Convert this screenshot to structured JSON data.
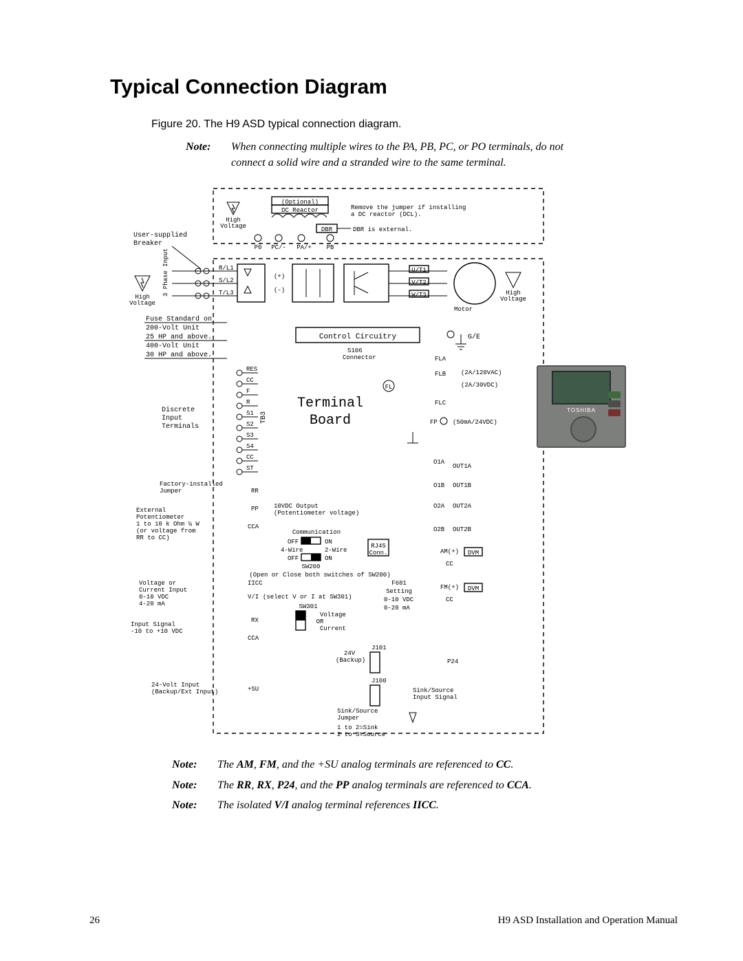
{
  "page": {
    "number": "26",
    "manual": "H9 ASD Installation and Operation Manual"
  },
  "heading": "Typical Connection Diagram",
  "figure_caption": "Figure 20. The H9 ASD typical connection diagram.",
  "top_note": {
    "label": "Note:",
    "body": "When connecting multiple wires to the PA, PB, PC, or PO terminals, do not connect a solid wire and a stranded wire to the same terminal."
  },
  "bottom_notes": [
    {
      "label": "Note:",
      "body": "The AM, FM, and the +SU analog terminals are referenced to CC."
    },
    {
      "label": "Note:",
      "body": "The RR, RX, P24, and the PP analog terminals are referenced to CCA."
    },
    {
      "label": "Note:",
      "body": "The isolated V/I analog terminal references IICC."
    }
  ],
  "diagram": {
    "top_labels": {
      "optional": "(Optional)",
      "dc_reactor": "DC Reactor",
      "jumper_note_l1": "Remove the jumper if installing",
      "jumper_note_l2": "a DC reactor (DCL).",
      "dbr": "DBR",
      "dbr_note": "DBR is external.",
      "hv": "High\nVoltage",
      "user_breaker_l1": "User-supplied",
      "user_breaker_l2": "Breaker",
      "p0": "P0",
      "pcminus": "PC/-",
      "paplus": "PA/+",
      "pb": "PB"
    },
    "phase_input": {
      "label": "3 Phase Input",
      "lines": [
        "R/L1",
        "S/L2",
        "T/L3"
      ],
      "plus": "(+)",
      "minus": "(-)"
    },
    "output": {
      "u": "U/T1",
      "v": "V/T2",
      "w": "W/T3",
      "motor": "Motor"
    },
    "fuse_note": [
      "Fuse Standard on",
      "200-Volt Unit",
      "25 HP and above.",
      "400-Volt Unit",
      "30 HP and above."
    ],
    "control": "Control Circuitry",
    "ge": "G/E",
    "s106": "S106",
    "s106b": "Connector",
    "terminal_board_l1": "Terminal",
    "terminal_board_l2": "Board",
    "tb3": "TB3",
    "discrete_label_l1": "Discrete",
    "discrete_label_l2": "Input",
    "discrete_label_l3": "Terminals",
    "discrete": [
      "RES",
      "CC",
      "F",
      "R",
      "S1",
      "S2",
      "S3",
      "S4",
      "CC",
      "ST"
    ],
    "fla": "FLA",
    "flb": "FLB",
    "flc": "FLC",
    "fl": "FL",
    "fla_rating": "(2A/120VAC)",
    "flb_rating": "(2A/30VDC)",
    "fp": "FP",
    "fp_rating": "(50mA/24VDC)",
    "jumper_factory_l1": "Factory-installed",
    "jumper_factory_l2": "Jumper",
    "rr": "RR",
    "pp": "PP",
    "pp_note_l1": "10VDC Output",
    "pp_note_l2": "(Potentiometer voltage)",
    "cca": "CCA",
    "ext_pot": [
      "External",
      "Potentiometer",
      "1 to 10 k Ohm ¼ W",
      "(or voltage from",
      "RR to CC)"
    ],
    "comm": "Communication",
    "off": "OFF",
    "on": "ON",
    "4wire": "4-Wire",
    "2wire": "2-Wire",
    "sw200": "SW200",
    "sw200_note": "(Open or Close both switches of SW200)",
    "rj45": "RJ45",
    "conn": "Conn.",
    "o1a": "O1A",
    "out1a": "OUT1A",
    "o1b": "O1B",
    "out1b": "OUT1B",
    "o2a": "O2A",
    "out2a": "OUT2A",
    "o2b": "O2B",
    "out2b": "OUT2B",
    "am": "AM(+)",
    "dvm": "DVM",
    "cc": "CC",
    "fm": "FM(+)",
    "iicc": "IICC",
    "vi": "V/I",
    "vi_sel": "(select V or I at SW301)",
    "sw301": "SW301",
    "voltage": "Voltage",
    "or": "OR",
    "current": "Current",
    "f681": "F681",
    "setting": "Setting",
    "set1": "0-10 VDC",
    "set2": "0-20 mA",
    "vc_label": [
      "Voltage or",
      "Current Input",
      "0-10 VDC",
      "4-20 mA"
    ],
    "rx": "RX",
    "input_signal_l1": "Input Signal",
    "input_signal_l2": "-10 to +10 VDC",
    "j101": "J101",
    "j100": "J100",
    "v24": "24V",
    "backup": "(Backup)",
    "p24": "P24",
    "su": "+SU",
    "v24_label_l1": "24-Volt Input",
    "v24_label_l2": "(Backup/Ext Input)",
    "ss_jumper_l1": "Sink/Source",
    "ss_jumper_l2": "Jumper",
    "ss_input_l1": "Sink/Source",
    "ss_input_l2": "Input Signal",
    "ss_note_l1": "1 to 2=Sink",
    "ss_note_l2": "2 to 3=Source",
    "keypad_brand": "TOSHIBA"
  }
}
